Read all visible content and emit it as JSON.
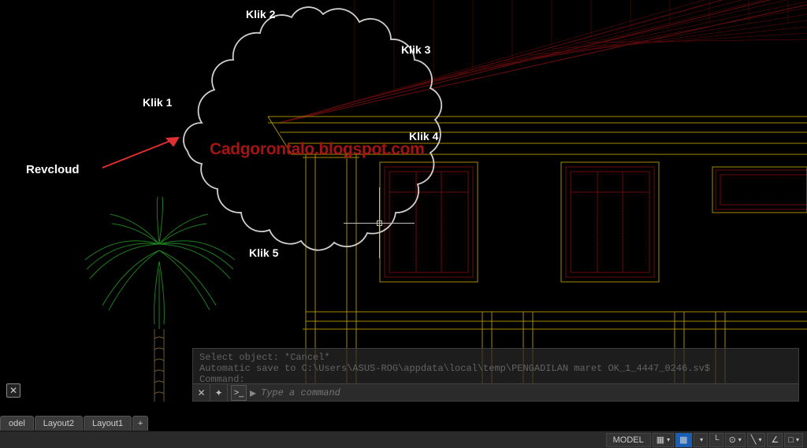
{
  "annotations": {
    "klik1": "Klik 1",
    "klik2": "Klik 2",
    "klik3": "Klik 3",
    "klik4": "Klik 4",
    "klik5": "Klik 5",
    "revcloud_label": "Revcloud"
  },
  "watermark": "Cadgorontalo.blogspot.com",
  "command": {
    "hist1": "Select object: *Cancel*",
    "hist2": "Automatic save to C:\\Users\\ASUS-ROG\\appdata\\local\\temp\\PENGADILAN maret OK_1_4447_0246.sv$",
    "hist3": "Command:",
    "placeholder": "Type a command",
    "prompt_glyph": ">_"
  },
  "tabs": {
    "model": "odel",
    "layout1": "Layout1",
    "layout2": "Layout2",
    "add": "+"
  },
  "status": {
    "model": "MODEL"
  }
}
